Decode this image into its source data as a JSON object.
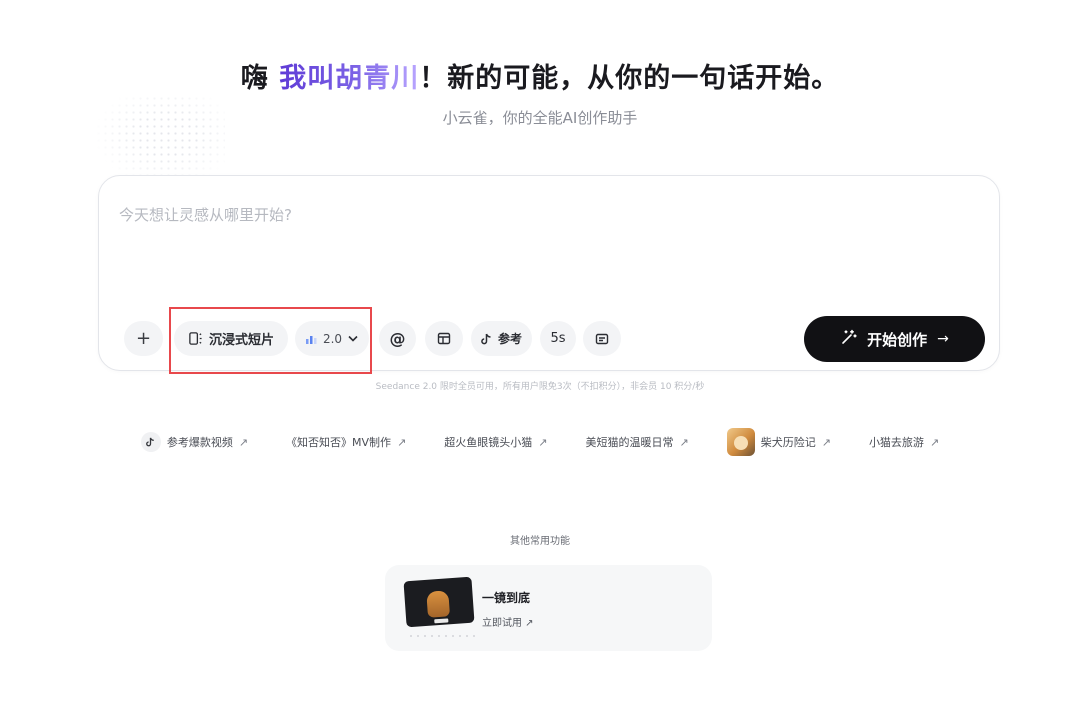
{
  "header": {
    "greeting": "嗨 ",
    "name": "我叫胡青川",
    "rest": "！新的可能，从你的一句话开始。",
    "subtitle": "小云雀，你的全能AI创作助手"
  },
  "composer": {
    "placeholder": "今天想让灵感从哪里开始?",
    "value": ""
  },
  "toolbar": {
    "add_label": "+",
    "mode_label": "沉浸式短片",
    "model_version": "2.0",
    "mention_label": "@",
    "reference_label": "参考",
    "duration_label": "5s"
  },
  "start_button": {
    "label": "开始创作",
    "arrow": "→"
  },
  "note": "Seedance 2.0 限时全员可用，所有用户限免3次（不扣积分），非会员 10 积分/秒",
  "suggestions": [
    {
      "label": "参考爆款视频",
      "arrow": "↗"
    },
    {
      "label": "《知否知否》MV制作",
      "arrow": "↗"
    },
    {
      "label": "超火鱼眼镜头小猫",
      "arrow": "↗"
    },
    {
      "label": "美短猫的温暖日常",
      "arrow": "↗"
    },
    {
      "label": "柴犬历险记",
      "arrow": "↗"
    },
    {
      "label": "小猫去旅游",
      "arrow": "↗"
    }
  ],
  "other_features": {
    "title": "其他常用功能",
    "items": [
      {
        "name": "一镜到底",
        "link": "立即试用 ↗"
      }
    ]
  },
  "colors": {
    "accent_purple": "#5f3bd6",
    "start_button_bg": "#111114",
    "highlight_red": "#e8484c"
  }
}
